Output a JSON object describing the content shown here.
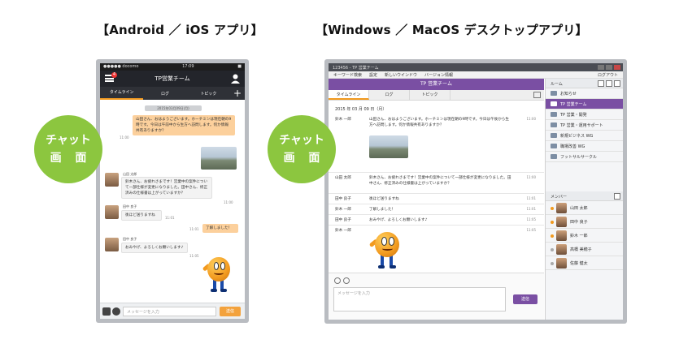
{
  "headings": {
    "mobile": "【Android ／ iOS アプリ】",
    "desktop": "【Windows ／ MacOS デスクトップアプリ】"
  },
  "badge": {
    "line1": "チャット",
    "line2": "画 面"
  },
  "phone": {
    "status": {
      "carrier": "●●●●● docomo",
      "time": "17:09",
      "battery": "■"
    },
    "header": {
      "title": "TP営業チーム",
      "notification_count": "4"
    },
    "tabs": [
      "タイムライン",
      "ログ",
      "トピック"
    ],
    "date_banner": "2015年03月09日(月)",
    "messages": [
      {
        "text": "山田さん、おはようございます。ホーチミンは現在朝の9時です。今日は午前中から生方へ訪問します。何か情報共有ありますか？",
        "time": "11:00"
      },
      {
        "name": "山田 太郎",
        "text": "鈴木さん、お疲れさまです！営業中の案件について一部仕様が変更になりました。田中さん、修正済みの仕様書は上がっていますか？",
        "time": "11:00"
      },
      {
        "name": "田中 良子",
        "text": "後ほど送りますね",
        "time": "11:01"
      },
      {
        "text": "了解しました！",
        "time": "11:01"
      },
      {
        "name": "田中 良子",
        "text": "おみやげ、よろしくお願いします♪",
        "time": "11:05"
      }
    ],
    "input_placeholder": "メッセージを入力",
    "send_label": "送信"
  },
  "desktop": {
    "window_title": "123456 - TP 営業チーム",
    "menu": [
      "キーワード検索",
      "設定",
      "新しいウインドウ",
      "バージョン情報"
    ],
    "logout": "ログアウト",
    "channel": "TP 営業チーム",
    "tabs": [
      "タイムライン",
      "ログ",
      "トピック"
    ],
    "date": "2015 年 03 月 09 日（月）",
    "rows": [
      {
        "name": "鈴木 一郎",
        "text": "山田さん、おはようございます。ホーチミンは現在朝の9時です。今日は午後から生方へ訪問します。何か情報共有ありますか？",
        "time": "11:00"
      },
      {
        "name": "山田 太郎",
        "text": "鈴木さん、お疲れさまです！営業中の案件について一部仕様が変更になりました。田中さん、修正済みの仕様書は上がっていますか？",
        "time": "11:00"
      },
      {
        "name": "田中 良子",
        "text": "後ほど送りますね",
        "time": "11:01"
      },
      {
        "name": "鈴木 一郎",
        "text": "了解しました！",
        "time": "11:01"
      },
      {
        "name": "田中 良子",
        "text": "おみやげ、よろしくお願いします♪",
        "time": "11:05"
      },
      {
        "name": "鈴木 一郎",
        "text": "",
        "time": "11:05"
      }
    ],
    "compose_placeholder": "メッセージを入力",
    "send_label": "送信",
    "rooms_header": "ルーム",
    "rooms": [
      "お知らせ",
      "TP 営業チーム",
      "TP 営業・開発",
      "TP 営業・運用サポート",
      "新規ビジネス WG",
      "職場改善 WG",
      "フットサルサークル"
    ],
    "members_header": "メンバー",
    "members": [
      "山田 太郎",
      "田中 良子",
      "鈴木 一郎",
      "高橋 美穂子",
      "佐藤 健太"
    ]
  }
}
